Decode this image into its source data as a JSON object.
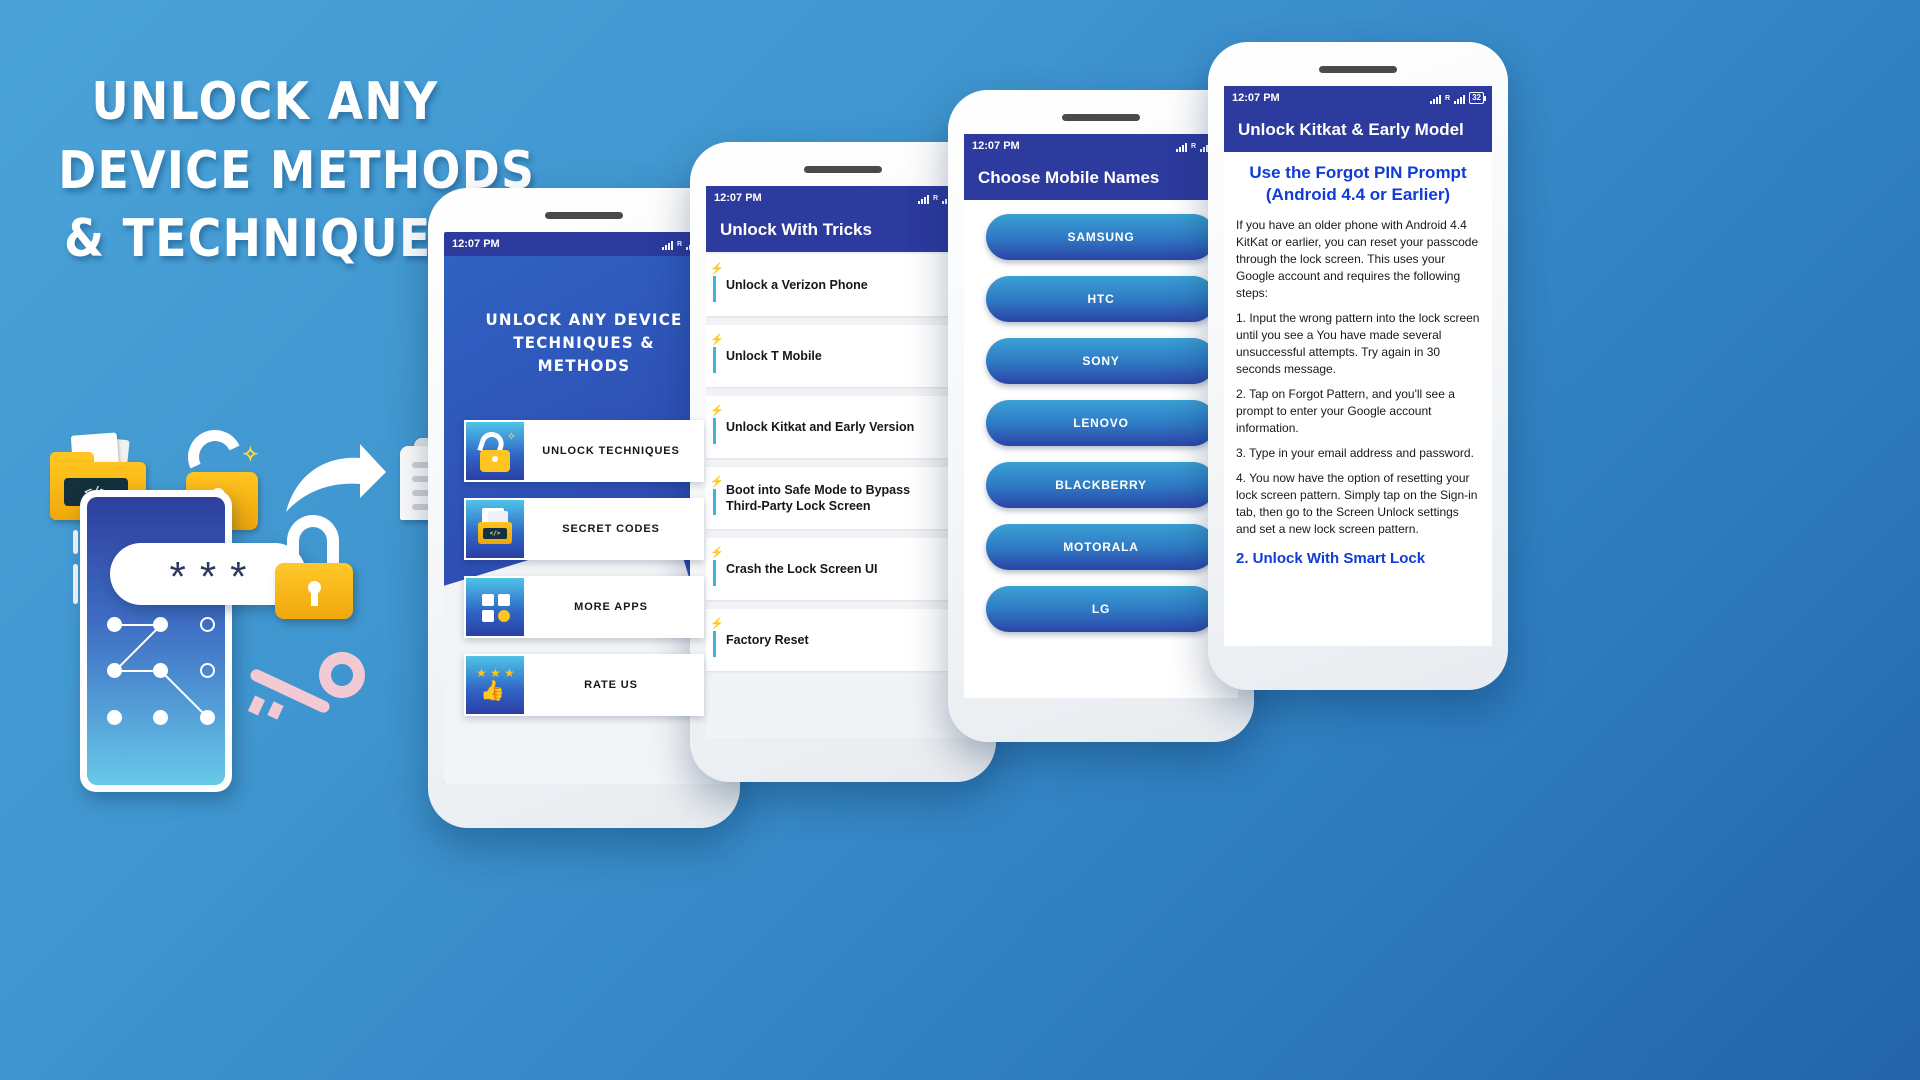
{
  "promo": {
    "title_lines": [
      "UNLOCK ANY",
      "DEVICE METHODS",
      "& TECHNIQUES"
    ],
    "icons": [
      "code-folder-icon",
      "open-padlock-icon",
      "share-arrow-icon",
      "document-stack-icon"
    ],
    "password_mask": [
      "*",
      "*",
      "*"
    ]
  },
  "colors": {
    "brand_blue": "#2d3a9e",
    "accent_yellow": "#ffc41f",
    "link_blue": "#0f3bd6",
    "background_blue": "#3f95cf"
  },
  "status_bar": {
    "time": "12:07 PM",
    "battery_level": "32",
    "signal_label": "R"
  },
  "phone1": {
    "title_lines": [
      "UNLOCK ANY DEVICE",
      "TECHNIQUES & METHODS"
    ],
    "menu": [
      {
        "label": "UNLOCK TECHNIQUES",
        "icon": "open-padlock-icon"
      },
      {
        "label": "SECRET CODES",
        "icon": "code-folder-icon"
      },
      {
        "label": "MORE APPS",
        "icon": "apps-grid-icon"
      },
      {
        "label": "RATE US",
        "icon": "thumbs-up-star-icon"
      }
    ]
  },
  "phone2": {
    "appbar_title": "Unlock With Tricks",
    "rows": [
      "Unlock a Verizon Phone",
      "Unlock T Mobile",
      "Unlock Kitkat and Early Version",
      "Boot into Safe Mode to Bypass Third-Party Lock Screen",
      "Crash the Lock Screen UI",
      "Factory Reset"
    ]
  },
  "phone3": {
    "appbar_title": "Choose Mobile Names",
    "brands": [
      "SAMSUNG",
      "HTC",
      "SONY",
      "LENOVO",
      "BLACKBERRY",
      "MOTORALA",
      "LG"
    ]
  },
  "phone4": {
    "appbar_title": "Unlock Kitkat & Early Model",
    "heading_lines": [
      "Use the Forgot PIN Prompt",
      "(Android 4.4 or Earlier)"
    ],
    "intro": "If you have an older phone with Android 4.4 KitKat or earlier, you can reset your passcode through the lock screen. This uses your Google account and requires the following steps:",
    "steps": [
      "1. Input the wrong pattern into the lock screen until you see a You have made several unsuccessful attempts. Try again in 30 seconds message.",
      "2. Tap on Forgot Pattern, and you'll see a prompt to enter your Google account information.",
      "3. Type in your email address and password.",
      "4. You now have the option of resetting your lock screen pattern. Simply tap on the Sign-in tab, then go to the Screen Unlock settings and set a new lock screen pattern."
    ],
    "footer_link": "2. Unlock With Smart Lock"
  }
}
